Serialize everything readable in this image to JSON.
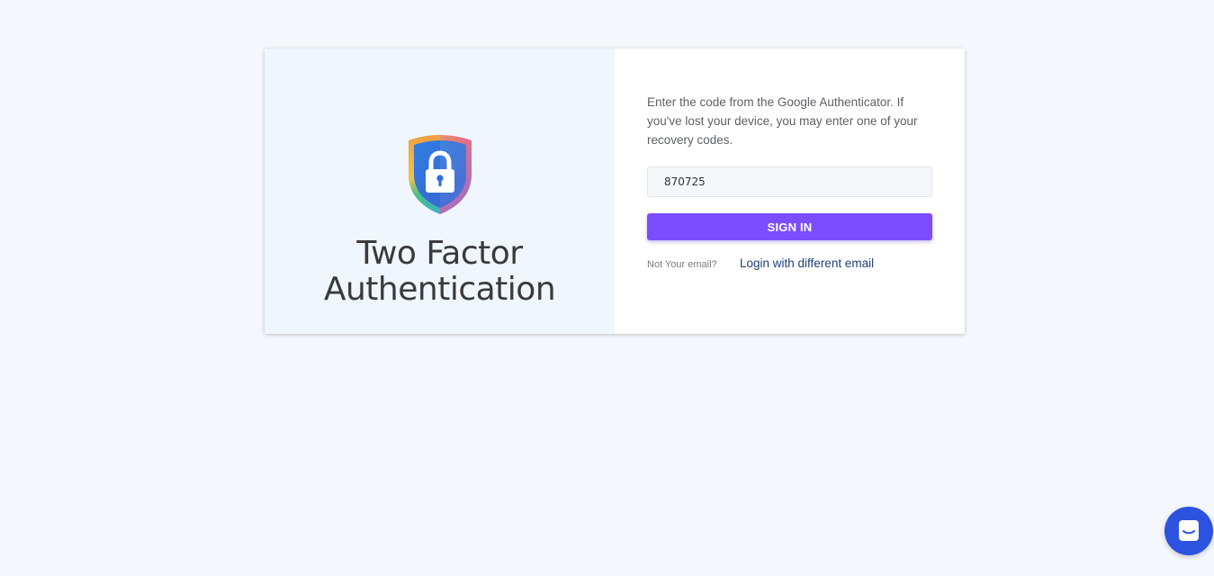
{
  "auth_card": {
    "title_line1": "Two Factor",
    "title_line2": "Authentication",
    "instructions": "Enter the code from the Google Authenticator. If you've lost your device, you may enter one of your recovery codes.",
    "code_value": "870725",
    "sign_in_label": "SIGN IN",
    "not_your_email": "Not Your email?",
    "different_email_link": "Login with different email"
  },
  "icons": {
    "shield": "shield-lock-icon",
    "chat": "chat-bubble-icon"
  },
  "colors": {
    "page_bg": "#f4f7fb",
    "left_panel_bg": "#eff6fd",
    "primary_button": "#7b4dff",
    "link": "#1d3f7a",
    "chat_launcher": "#2c52e0"
  }
}
